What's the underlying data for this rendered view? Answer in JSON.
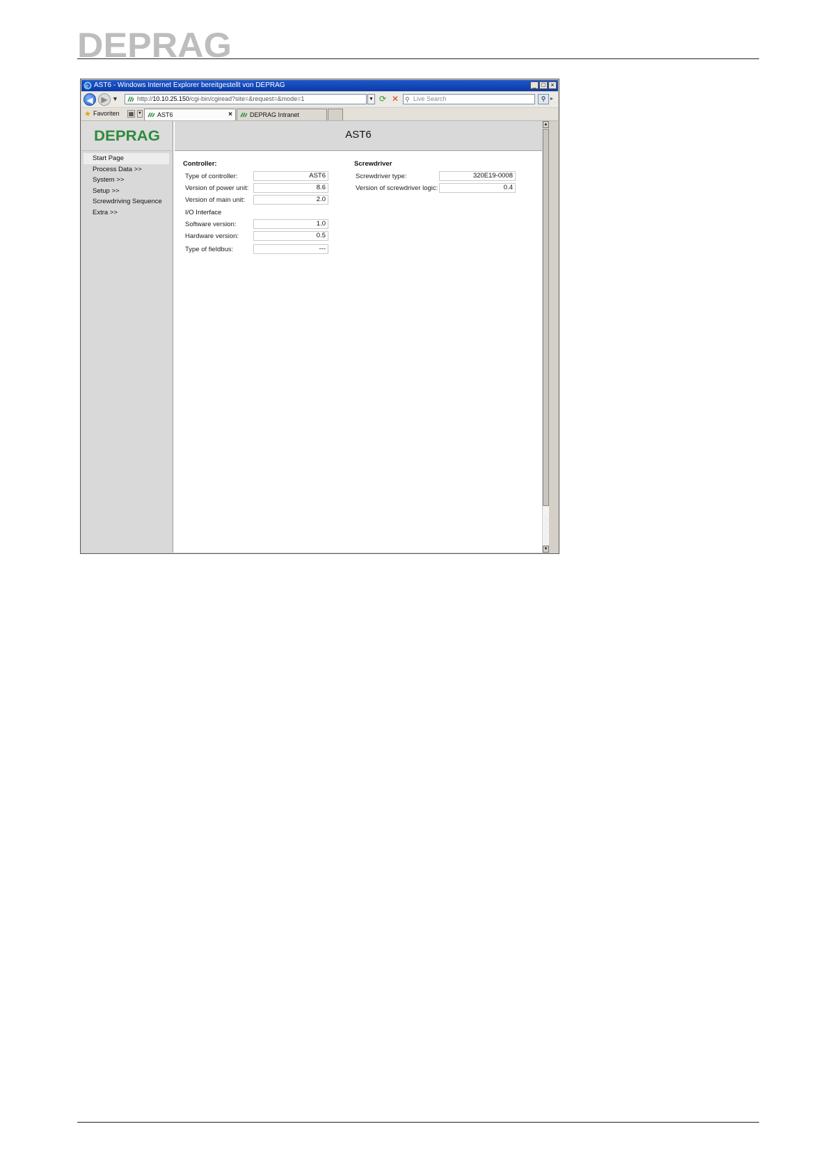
{
  "document": {
    "brand_logo_text": "DEPRAG"
  },
  "browser": {
    "window_title": "AST6 - Windows Internet Explorer bereitgestellt von DEPRAG",
    "address_prefix": "http://",
    "address_host": "10.10.25.150",
    "address_path": "/cgi-bin/cgiread?site=&request=&mode=1",
    "search_placeholder": "Live Search",
    "favorites_label": "Favoriten",
    "tabs": [
      {
        "label": "AST6",
        "active": true
      },
      {
        "label": "DEPRAG Intranet",
        "active": false
      }
    ]
  },
  "app": {
    "logo_text": "DEPRAG",
    "page_title": "AST6",
    "menu": [
      {
        "label": "Start Page",
        "active": true
      },
      {
        "label": "Process Data >>"
      },
      {
        "label": "System >>"
      },
      {
        "label": "Setup >>"
      },
      {
        "label": "Screwdriving Sequence"
      },
      {
        "label": "Extra >>"
      }
    ],
    "controller": {
      "title": "Controller:",
      "rows": [
        {
          "label": "Type of controller:",
          "value": "AST6"
        },
        {
          "label": "Version of power unit:",
          "value": "8.6"
        },
        {
          "label": "Version of main unit:",
          "value": "2.0"
        }
      ]
    },
    "io_interface": {
      "title": "I/O Interface",
      "rows": [
        {
          "label": "Software version:",
          "value": "1.0"
        },
        {
          "label": "Hardware version:",
          "value": "0.5"
        },
        {
          "label": "Type of fieldbus:",
          "value": "---"
        }
      ]
    },
    "screwdriver": {
      "title": "Screwdriver",
      "rows": [
        {
          "label": "Screwdriver type:",
          "value": "320E19-0008"
        },
        {
          "label": "Version of screwdriver logic:",
          "value": "0.4"
        }
      ]
    }
  },
  "colors": {
    "brand_gray": "#bdbdbd",
    "brand_green": "#2e8b3c",
    "titlebar_blue": "#0a3aa8"
  }
}
